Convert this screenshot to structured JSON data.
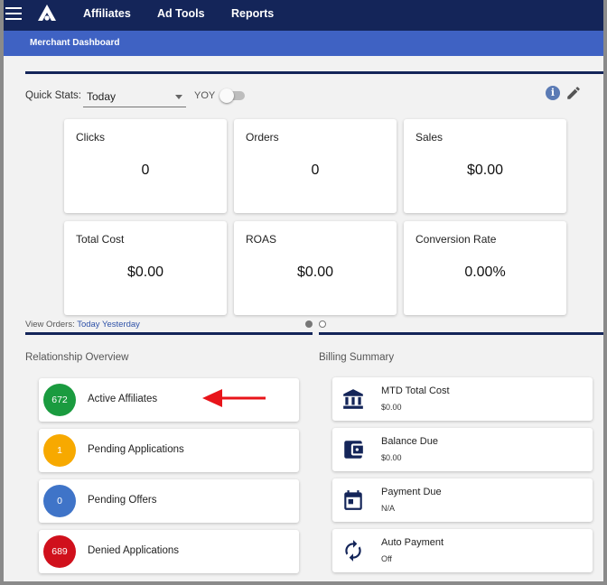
{
  "nav": {
    "items": [
      "Affiliates",
      "Ad Tools",
      "Reports"
    ],
    "subnav_title": "Merchant Dashboard"
  },
  "quick_stats": {
    "label": "Quick Stats:",
    "period": "Today",
    "yoy_label": "YOY",
    "yoy_enabled": false,
    "info_glyph": "i",
    "cards": [
      {
        "title": "Clicks",
        "value": "0"
      },
      {
        "title": "Orders",
        "value": "0"
      },
      {
        "title": "Sales",
        "value": "$0.00"
      },
      {
        "title": "Total Cost",
        "value": "$0.00"
      },
      {
        "title": "ROAS",
        "value": "$0.00"
      },
      {
        "title": "Conversion Rate",
        "value": "0.00%"
      }
    ]
  },
  "view_orders": {
    "label": "View Orders:",
    "today": "Today",
    "yesterday": "Yesterday"
  },
  "relationship_overview": {
    "title": "Relationship Overview",
    "items": [
      {
        "count": "672",
        "label": "Active Affiliates",
        "color": "#1a9b3f"
      },
      {
        "count": "1",
        "label": "Pending Applications",
        "color": "#f7a900"
      },
      {
        "count": "0",
        "label": "Pending Offers",
        "color": "#3f74c8"
      },
      {
        "count": "689",
        "label": "Denied Applications",
        "color": "#d0101c"
      }
    ]
  },
  "billing_summary": {
    "title": "Billing Summary",
    "items": [
      {
        "label": "MTD Total Cost",
        "value": "$0.00",
        "icon": "bank-icon"
      },
      {
        "label": "Balance Due",
        "value": "$0.00",
        "icon": "wallet-icon"
      },
      {
        "label": "Payment Due",
        "value": "N/A",
        "icon": "calendar-icon"
      },
      {
        "label": "Auto Payment",
        "value": "Off",
        "icon": "autorenew-icon"
      }
    ]
  },
  "colors": {
    "nav_bg": "#142559",
    "subnav_bg": "#3f62c3",
    "icon_navy": "#142559",
    "annotation_arrow": "#e8141a"
  }
}
